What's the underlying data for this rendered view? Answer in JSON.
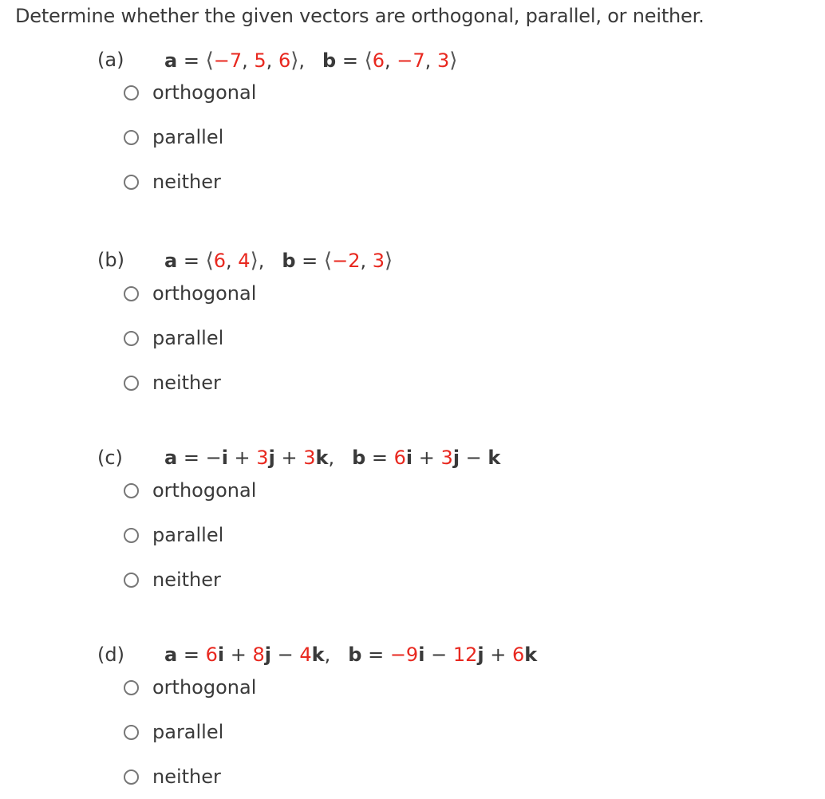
{
  "instruction": "Determine whether the given vectors are orthogonal, parallel, or neither.",
  "options": [
    "orthogonal",
    "parallel",
    "neither"
  ],
  "colors": {
    "highlight": "#e8281f",
    "text": "#3a3a3a"
  },
  "parts": [
    {
      "label": "(a)",
      "a": {
        "name": "a",
        "eq": " = ",
        "open": "⟨",
        "c1": "−7",
        "s1": ", ",
        "c2": "5",
        "s2": ", ",
        "c3": "6",
        "close": "⟩",
        "tail": ","
      },
      "b": {
        "name": "b",
        "eq": " = ",
        "open": "⟨",
        "c1": "6",
        "s1": ", ",
        "c2": "−7",
        "s2": ", ",
        "c3": "3",
        "close": "⟩"
      },
      "selected": null
    },
    {
      "label": "(b)",
      "a": {
        "name": "a",
        "eq": " = ",
        "open": "⟨",
        "c1": "6",
        "s1": ", ",
        "c2": "4",
        "close": "⟩",
        "tail": ","
      },
      "b": {
        "name": "b",
        "eq": " = ",
        "open": "⟨",
        "c1": "−2",
        "s1": ", ",
        "c2": "3",
        "close": "⟩"
      },
      "selected": null
    },
    {
      "label": "(c)",
      "a": {
        "name": "a",
        "eq": " = ",
        "t1": "−",
        "u1": "i",
        "op1": " + ",
        "c2": "3",
        "u2": "j",
        "op2": " + ",
        "c3": "3",
        "u3": "k",
        "tail": ","
      },
      "b": {
        "name": "b",
        "eq": " = ",
        "c1": "6",
        "u1": "i",
        "op1": " + ",
        "c2": "3",
        "u2": "j",
        "op2": " − ",
        "u3": "k"
      },
      "selected": null
    },
    {
      "label": "(d)",
      "a": {
        "name": "a",
        "eq": " = ",
        "c1": "6",
        "u1": "i",
        "op1": " + ",
        "c2": "8",
        "u2": "j",
        "op2": " − ",
        "c3": "4",
        "u3": "k",
        "tail": ","
      },
      "b": {
        "name": "b",
        "eq": " = ",
        "c1": "−9",
        "u1": "i",
        "op1": " − ",
        "c2": "12",
        "u2": "j",
        "op2": " + ",
        "c3": "6",
        "u3": "k"
      },
      "selected": null
    }
  ]
}
